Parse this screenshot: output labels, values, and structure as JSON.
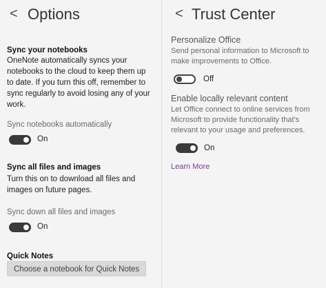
{
  "left": {
    "back_glyph": "<",
    "title": "Options",
    "sync_notebooks": {
      "heading": "Sync your notebooks",
      "desc_lines": [
        "OneNote automatically syncs your",
        "notebooks to the cloud to keep them up",
        "to date. If you turn this off, remember to",
        "sync regularly to avoid losing any of your",
        "work."
      ],
      "setting_label": "Sync notebooks automatically",
      "toggle_state": "On"
    },
    "sync_files": {
      "heading": "Sync all files and images",
      "desc_lines": [
        "Turn this on to download all files and",
        "images on future pages."
      ],
      "setting_label": "Sync down all files and images",
      "toggle_state": "On"
    },
    "quick_notes": {
      "heading": "Quick Notes",
      "button_label": "Choose a notebook for Quick Notes"
    }
  },
  "right": {
    "back_glyph": "<",
    "title": "Trust Center",
    "personalize": {
      "heading": "Personalize Office",
      "desc_lines": [
        "Send personal information to Microsoft to",
        "make improvements to Office."
      ],
      "toggle_state": "Off"
    },
    "local_content": {
      "heading": "Enable locally relevant content",
      "desc_lines": [
        "Let Office connect to online services from",
        "Microsoft to provide functionality that's",
        "relevant to your usage and preferences."
      ],
      "toggle_state": "On"
    },
    "learn_more": "Learn More"
  },
  "colors": {
    "link": "#7a3b8f",
    "toggle_on": "#3a3a3a"
  },
  "icons": {
    "back": "back-arrow-icon"
  }
}
